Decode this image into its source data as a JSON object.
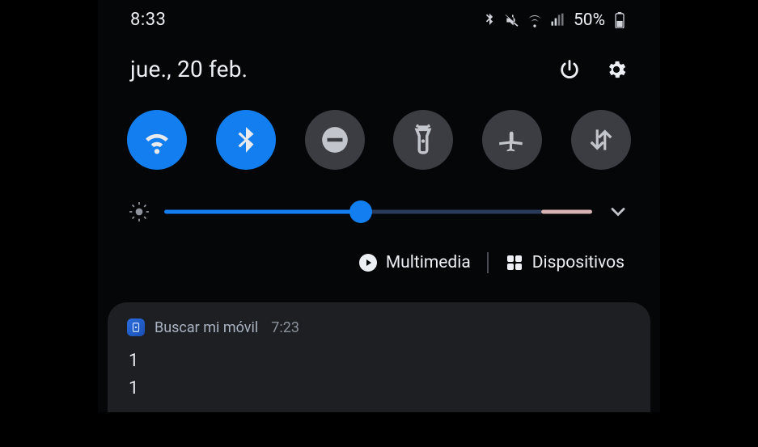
{
  "status": {
    "time": "8:33",
    "battery_pct": "50%"
  },
  "date": "jue., 20 feb.",
  "toggles": [
    {
      "name": "wifi",
      "on": true
    },
    {
      "name": "bluetooth",
      "on": true
    },
    {
      "name": "dnd",
      "on": false
    },
    {
      "name": "flashlight",
      "on": false
    },
    {
      "name": "airplane",
      "on": false
    },
    {
      "name": "data",
      "on": false
    }
  ],
  "brightness": {
    "value": 46
  },
  "shortcuts": {
    "media_label": "Multimedia",
    "devices_label": "Dispositivos"
  },
  "notification": {
    "app_name": "Buscar mi móvil",
    "time": "7:23",
    "title": "1",
    "body": "1"
  }
}
